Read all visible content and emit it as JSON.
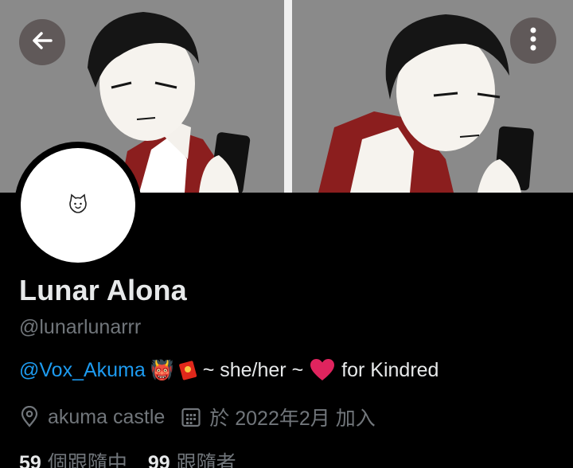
{
  "profile": {
    "display_name": "Lunar Alona",
    "handle": "@lunarlunarrr",
    "bio": {
      "mention": "@Vox_Akuma",
      "emoji_1": "👹",
      "pronouns": "~ she/her ~",
      "tail": "for Kindred"
    },
    "location": "akuma castle",
    "joined": "於 2022年2月 加入",
    "following_count": "59",
    "following_label": "個跟隨中",
    "followers_count": "99",
    "followers_label": "跟隨者"
  },
  "icons": {
    "back": "back-arrow-icon",
    "more": "more-vertical-icon",
    "location": "location-pin-icon",
    "calendar": "calendar-icon"
  },
  "colors": {
    "background": "#000000",
    "link": "#1d9bf0",
    "secondary_text": "#71767b",
    "primary_text": "#e7e9ea",
    "heart": "#e0245e"
  }
}
